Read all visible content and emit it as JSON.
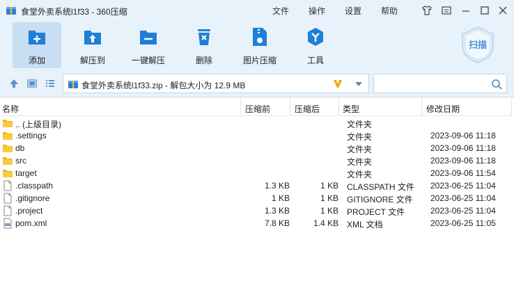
{
  "window": {
    "title": "食堂外卖系统l1f33 - 360压缩",
    "menu": [
      "文件",
      "操作",
      "设置",
      "帮助"
    ],
    "accent": "#1e7fd8",
    "chrome_bg": "#e8f2fb"
  },
  "toolbar": {
    "buttons": [
      {
        "label": "添加",
        "icon": "add-icon"
      },
      {
        "label": "解压到",
        "icon": "extract-to-icon"
      },
      {
        "label": "一键解压",
        "icon": "one-click-extract-icon"
      },
      {
        "label": "删除",
        "icon": "delete-icon"
      },
      {
        "label": "图片压缩",
        "icon": "image-compress-icon"
      },
      {
        "label": "工具",
        "icon": "tools-icon"
      }
    ],
    "scan_label": "扫描"
  },
  "address": {
    "path": "食堂外卖系统l1f33.zip - 解包大小为 12.9 MB",
    "search_placeholder": ""
  },
  "table": {
    "columns": {
      "name": "名称",
      "compressed": "压缩前",
      "size": "压缩后",
      "type": "类型",
      "modified": "修改日期"
    },
    "rows": [
      {
        "name": ".. (上级目录)",
        "compressed": "",
        "size": "",
        "type": "文件夹",
        "modified": "",
        "kind": "folder"
      },
      {
        "name": ".settings",
        "compressed": "",
        "size": "",
        "type": "文件夹",
        "modified": "2023-09-06 11:18",
        "kind": "folder"
      },
      {
        "name": "db",
        "compressed": "",
        "size": "",
        "type": "文件夹",
        "modified": "2023-09-06 11:18",
        "kind": "folder"
      },
      {
        "name": "src",
        "compressed": "",
        "size": "",
        "type": "文件夹",
        "modified": "2023-09-06 11:18",
        "kind": "folder"
      },
      {
        "name": "target",
        "compressed": "",
        "size": "",
        "type": "文件夹",
        "modified": "2023-09-06 11:54",
        "kind": "folder"
      },
      {
        "name": ".classpath",
        "compressed": "1.3 KB",
        "size": "1 KB",
        "type": "CLASSPATH 文件",
        "modified": "2023-06-25 11:04",
        "kind": "file"
      },
      {
        "name": ".gitignore",
        "compressed": "1 KB",
        "size": "1 KB",
        "type": "GITIGNORE 文件",
        "modified": "2023-06-25 11:04",
        "kind": "file"
      },
      {
        "name": ".project",
        "compressed": "1.3 KB",
        "size": "1 KB",
        "type": "PROJECT 文件",
        "modified": "2023-06-25 11:04",
        "kind": "file"
      },
      {
        "name": "pom.xml",
        "compressed": "7.8 KB",
        "size": "1.4 KB",
        "type": "XML 文档",
        "modified": "2023-06-25 11:05",
        "kind": "xml"
      }
    ]
  }
}
